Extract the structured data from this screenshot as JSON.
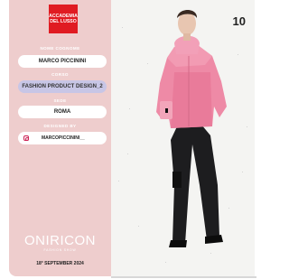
{
  "logo": {
    "line1": "ACCADEMIA",
    "line2": "DEL LUSSO"
  },
  "fields": {
    "name_label": "NOME COGNOME",
    "name_value": "MARCO PICCININI",
    "course_label": "CORSO",
    "course_value": "FASHION PRODUCT DESIGN_2",
    "site_label": "SEDE",
    "site_value": "ROMA",
    "designer_label": "DESIGNED BY",
    "instagram_handle": "MARCOPICCININI__"
  },
  "event": {
    "brand": "ONIRICON",
    "brand_sub": "FASHION SHOW",
    "date": "18° SEPTEMBER 2024"
  },
  "look_number": "10",
  "colors": {
    "panel": "#eecdcd",
    "logo_red": "#e01b22",
    "course_pill": "#c8c6e6",
    "jacket_pink": "#ee8aa6"
  },
  "icons": {
    "social": "instagram-icon"
  }
}
